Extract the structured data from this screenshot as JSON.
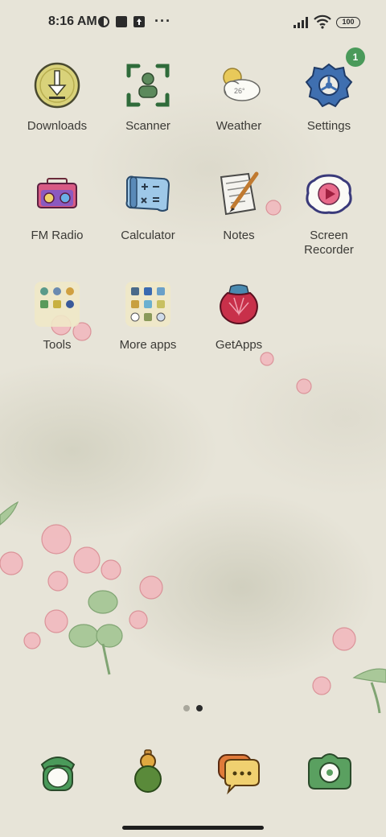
{
  "status_bar": {
    "time": "8:16 AM",
    "battery": "100",
    "icons": [
      "vpn-key-icon",
      "square-notification-icon",
      "upload-notification-icon",
      "more-dots-icon",
      "signal-icon",
      "wifi-icon",
      "battery-icon"
    ]
  },
  "apps": [
    {
      "label": "Downloads",
      "icon": "download-icon"
    },
    {
      "label": "Scanner",
      "icon": "scanner-icon"
    },
    {
      "label": "Weather",
      "icon": "weather-icon"
    },
    {
      "label": "Settings",
      "icon": "settings-icon",
      "badge": "1"
    },
    {
      "label": "FM Radio",
      "icon": "radio-icon"
    },
    {
      "label": "Calculator",
      "icon": "calculator-icon"
    },
    {
      "label": "Notes",
      "icon": "notes-icon"
    },
    {
      "label": "Screen Recorder",
      "icon": "screen-recorder-icon"
    },
    {
      "label": "Tools",
      "icon": "folder-icon"
    },
    {
      "label": "More apps",
      "icon": "folder-icon"
    },
    {
      "label": "GetApps",
      "icon": "getapps-icon"
    }
  ],
  "weather_icon_text": "26°",
  "page_indicator": {
    "pages": 2,
    "active": 2
  },
  "dock": [
    {
      "icon": "phone-icon"
    },
    {
      "icon": "gourd-icon"
    },
    {
      "icon": "messages-icon"
    },
    {
      "icon": "camera-icon"
    }
  ],
  "colors": {
    "background": "#e7e4d8",
    "badge": "#4a9a5a",
    "text": "#3b3a36"
  }
}
